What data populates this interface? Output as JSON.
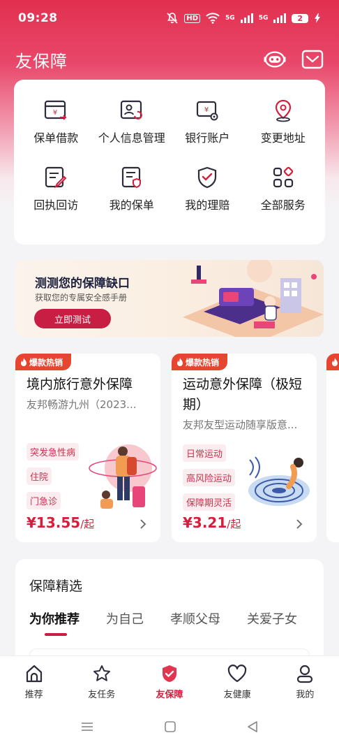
{
  "status_bar": {
    "time": "09:28",
    "hd": "HD",
    "network_5g_1": "5G",
    "network_5g_2": "5G",
    "battery": "2"
  },
  "header": {
    "title": "友保障"
  },
  "services": [
    {
      "label": "保单借款",
      "icon": "loan-icon"
    },
    {
      "label": "个人信息管理",
      "icon": "profile-card-icon"
    },
    {
      "label": "银行账户",
      "icon": "bank-account-icon"
    },
    {
      "label": "变更地址",
      "icon": "location-pin-icon"
    },
    {
      "label": "回执回访",
      "icon": "receipt-edit-icon"
    },
    {
      "label": "我的保单",
      "icon": "policy-icon"
    },
    {
      "label": "我的理赔",
      "icon": "claim-shield-icon"
    },
    {
      "label": "全部服务",
      "icon": "all-services-icon"
    }
  ],
  "banner": {
    "title": "测测您的保障缺口",
    "subtitle": "获取您的专属安全感手册",
    "button": "立即测试"
  },
  "products": [
    {
      "hot_label": "爆款热销",
      "title": "境内旅行意外保障",
      "subtitle": "友邦畅游九州（2023...",
      "tags": [
        "突发急性病",
        "住院",
        "门急诊"
      ],
      "price": "¥13.55",
      "price_unit": "/起"
    },
    {
      "hot_label": "爆款热销",
      "title": "运动意外保障（极短期）",
      "subtitle": "友邦友型运动随享版意...",
      "tags": [
        "日常运动",
        "高风险运动",
        "保障期灵活"
      ],
      "price": "¥3.21",
      "price_unit": "/起"
    }
  ],
  "picks": {
    "title": "保障精选",
    "tabs": [
      "为你推荐",
      "为自己",
      "孝顺父母",
      "关爱子女"
    ],
    "active_tab": 0
  },
  "bottom_nav": [
    {
      "label": "推荐",
      "icon": "home-icon"
    },
    {
      "label": "友任务",
      "icon": "star-icon"
    },
    {
      "label": "友保障",
      "icon": "shield-icon"
    },
    {
      "label": "友健康",
      "icon": "heart-icon"
    },
    {
      "label": "我的",
      "icon": "user-icon"
    }
  ],
  "colors": {
    "brand": "#d61e3c",
    "accent": "#c81e43",
    "hot_tag": "#e6452f"
  }
}
